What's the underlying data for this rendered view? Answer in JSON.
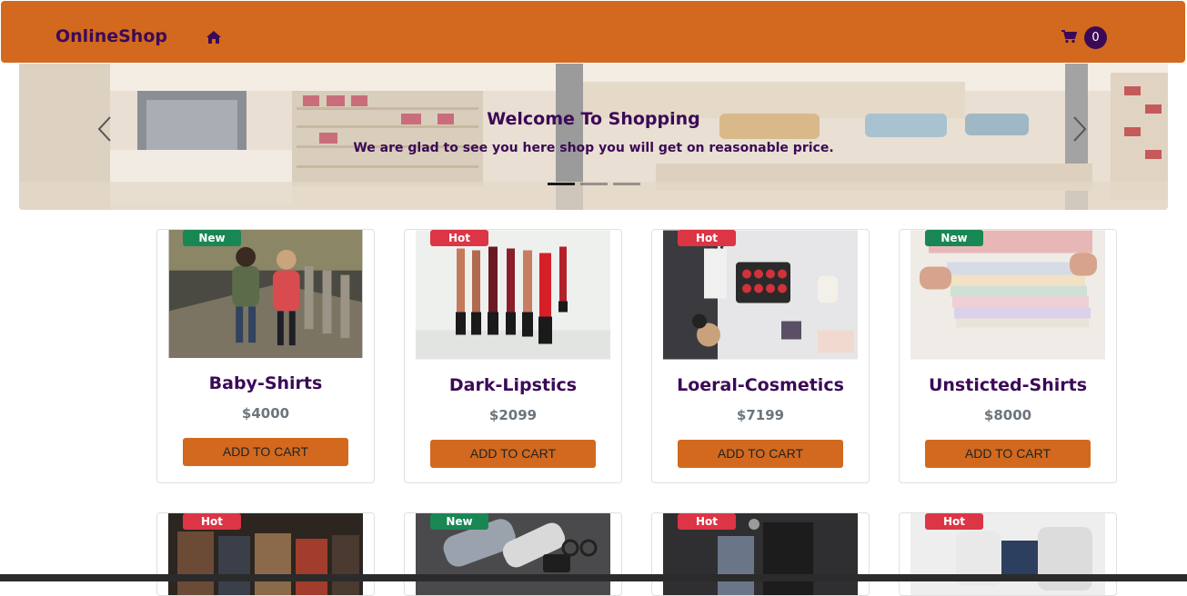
{
  "navbar": {
    "brand": "OnlineShop",
    "cart_count": "0",
    "color": "#d2691e"
  },
  "carousel": {
    "title": "Welcome To Shopping",
    "subtitle": "We are glad to see you here shop you will get on reasonable price.",
    "slide_count": 3,
    "active_slide": 1
  },
  "products": [
    {
      "badge": "New",
      "name": "Baby-Shirts",
      "price": "$4000",
      "button": "ADD TO CART"
    },
    {
      "badge": "Hot",
      "name": "Dark-Lipstics",
      "price": "$2099",
      "button": "ADD TO CART"
    },
    {
      "badge": "Hot",
      "name": "Loeral-Cosmetics",
      "price": "$7199",
      "button": "ADD TO CART"
    },
    {
      "badge": "New",
      "name": "Unsticted-Shirts",
      "price": "$8000",
      "button": "ADD TO CART"
    },
    {
      "badge": "Hot"
    },
    {
      "badge": "New"
    },
    {
      "badge": "Hot"
    },
    {
      "badge": "Hot"
    }
  ],
  "colors": {
    "brand_text": "#3b0a57",
    "badge_new": "#198754",
    "badge_hot": "#dc3545",
    "price_text": "#6c757d"
  },
  "icons": [
    "home-icon",
    "shopping-cart-icon",
    "chevron-left-icon",
    "chevron-right-icon"
  ]
}
